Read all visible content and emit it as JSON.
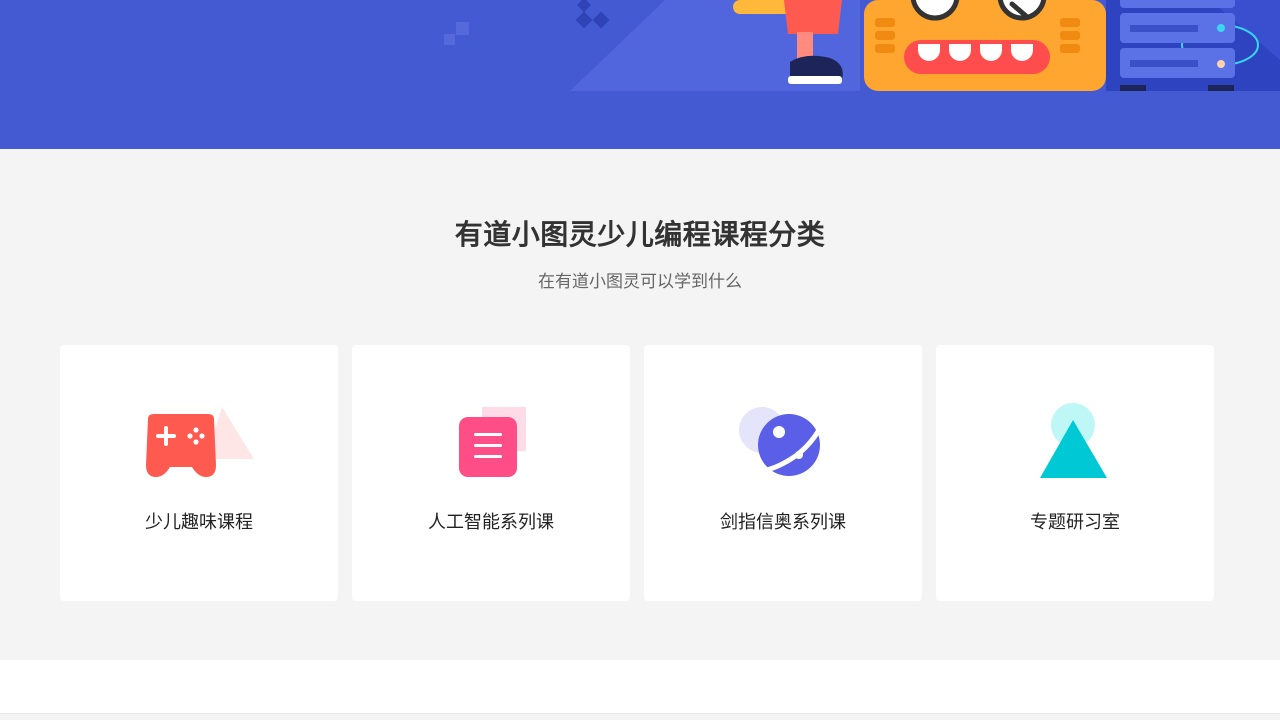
{
  "section": {
    "title": "有道小图灵少儿编程课程分类",
    "subtitle": "在有道小图灵可以学到什么"
  },
  "cards": [
    {
      "label": "少儿趣味课程",
      "icon": "gamepad-icon"
    },
    {
      "label": "人工智能系列课",
      "icon": "document-icon"
    },
    {
      "label": "剑指信奥系列课",
      "icon": "planet-icon"
    },
    {
      "label": "专题研习室",
      "icon": "triangle-icon"
    }
  ],
  "colors": {
    "banner": "#445ad2",
    "gamepad": "#ff5a4f",
    "document": "#ff4d88",
    "planet": "#5b5ee6",
    "triangle": "#00c9d6"
  }
}
